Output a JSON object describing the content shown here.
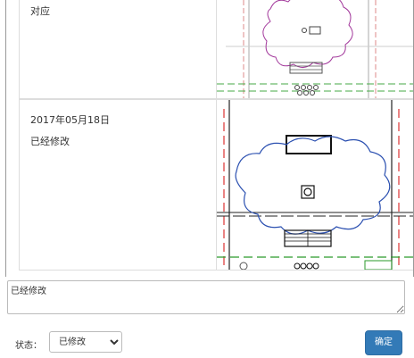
{
  "rows": [
    {
      "label": "对应"
    },
    {
      "date": "2017年05月18日",
      "status_text": "已经修改"
    }
  ],
  "comment": {
    "value": "已经修改"
  },
  "status": {
    "label": "状态：",
    "selected": "已修改"
  },
  "confirm_label": "确定"
}
